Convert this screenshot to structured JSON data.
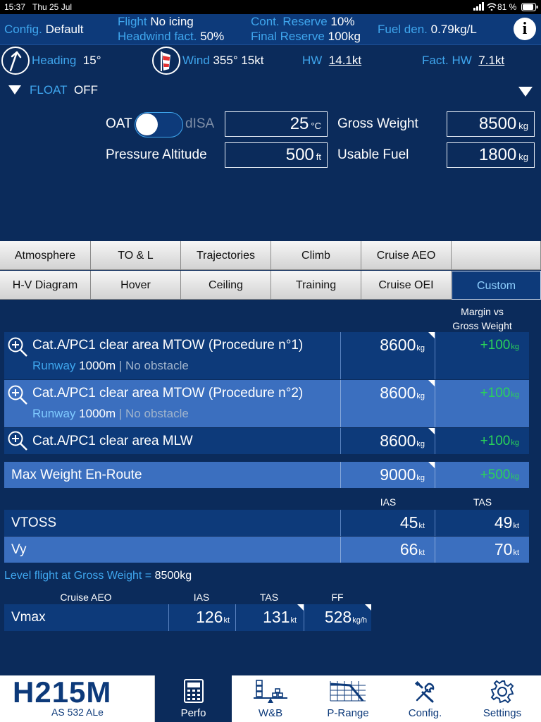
{
  "status": {
    "time": "15:37",
    "date": "Thu 25 Jul",
    "battery": "81 %"
  },
  "header1": {
    "config_label": "Config.",
    "config_value": "Default",
    "flight_label": "Flight",
    "flight_value": "No icing",
    "headwind_label": "Headwind fact.",
    "headwind_value": "50%",
    "cont_reserve_label": "Cont. Reserve",
    "cont_reserve_value": "10%",
    "final_reserve_label": "Final Reserve",
    "final_reserve_value": "100kg",
    "fuel_den_label": "Fuel den.",
    "fuel_den_value": "0.79kg/L",
    "info_icon": "info-icon"
  },
  "header2": {
    "heading_label": "Heading",
    "heading_value": "15°",
    "wind_label": "Wind",
    "wind_value": "355° 15kt",
    "hw_label": "HW",
    "hw_value": "14.1kt",
    "fact_hw_label": "Fact. HW",
    "fact_hw_value": "7.1kt"
  },
  "float": {
    "label": "FLOAT",
    "value": "OFF"
  },
  "inputs": {
    "oat_label": "OAT",
    "disa_label": "dISA",
    "oat_value": "25",
    "oat_unit": "°C",
    "pressure_alt_label": "Pressure Altitude",
    "pressure_alt_value": "500",
    "pressure_alt_unit": "ft",
    "gross_weight_label": "Gross Weight",
    "gross_weight_value": "8500",
    "gross_weight_unit": "kg",
    "usable_fuel_label": "Usable Fuel",
    "usable_fuel_value": "1800",
    "usable_fuel_unit": "kg"
  },
  "tabs_row1": [
    "Atmosphere",
    "TO & L",
    "Trajectories",
    "Climb",
    "Cruise AEO",
    ""
  ],
  "tabs_row2": [
    "H-V Diagram",
    "Hover",
    "Ceiling",
    "Training",
    "Cruise OEI",
    "Custom"
  ],
  "margin_header": [
    "Margin vs",
    "Gross Weight"
  ],
  "weights": [
    {
      "title": "Cat.A/PC1 clear area MTOW (Procedure n°1)",
      "sub_label": "Runway",
      "sub_value": "1000m",
      "sub_sep": "|",
      "sub_extra": "No obstacle",
      "value": "8600",
      "unit": "kg",
      "margin": "+100",
      "margin_unit": "kg"
    },
    {
      "title": "Cat.A/PC1 clear area MTOW (Procedure n°2)",
      "sub_label": "Runway",
      "sub_value": "1000m",
      "sub_sep": "|",
      "sub_extra": "No obstacle",
      "value": "8600",
      "unit": "kg",
      "margin": "+100",
      "margin_unit": "kg"
    },
    {
      "title": "Cat.A/PC1 clear area MLW",
      "value": "8600",
      "unit": "kg",
      "margin": "+100",
      "margin_unit": "kg"
    }
  ],
  "enroute": {
    "title": "Max Weight En-Route",
    "value": "9000",
    "unit": "kg",
    "margin": "+500",
    "margin_unit": "kg"
  },
  "speeds_header": {
    "ias": "IAS",
    "tas": "TAS"
  },
  "speeds": [
    {
      "name": "VTOSS",
      "ias": "45",
      "tas": "49",
      "unit": "kt"
    },
    {
      "name": "Vy",
      "ias": "66",
      "tas": "70",
      "unit": "kt"
    }
  ],
  "level_flight": {
    "label": "Level flight at Gross Weight =",
    "value": "8500kg"
  },
  "cruise": {
    "col_name": "Cruise AEO",
    "col_ias": "IAS",
    "col_tas": "TAS",
    "col_ff": "FF",
    "name": "Vmax",
    "ias": "126",
    "ias_unit": "kt",
    "tas": "131",
    "tas_unit": "kt",
    "ff": "528",
    "ff_unit": "kg/h"
  },
  "nav": {
    "logo": "H215M",
    "logo_sub": "AS 532 ALe",
    "items": [
      "Perfo",
      "W&B",
      "P-Range",
      "Config.",
      "Settings"
    ]
  }
}
